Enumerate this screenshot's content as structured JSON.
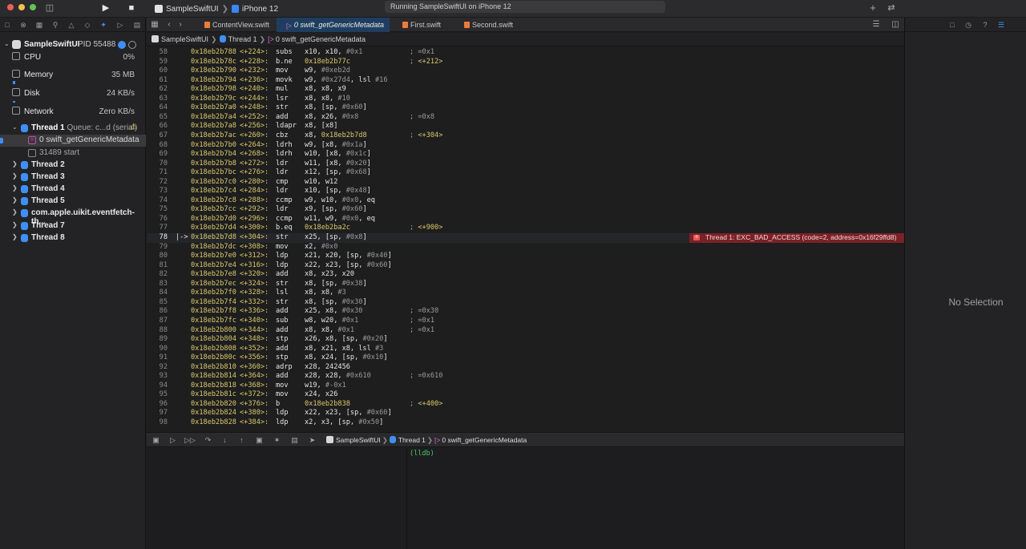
{
  "toolbar": {
    "scheme_app": "SampleSwiftUI",
    "scheme_device": "iPhone 12",
    "status": "Running SampleSwiftUI on iPhone 12"
  },
  "navigator": {
    "process_name": "SampleSwiftUI",
    "process_pid": "PID 55488",
    "gauges": [
      {
        "label": "CPU",
        "value": "0%",
        "level": 0.0
      },
      {
        "label": "Memory",
        "value": "35 MB",
        "level": 0.55
      },
      {
        "label": "Disk",
        "value": "24 KB/s",
        "level": 0.25
      },
      {
        "label": "Network",
        "value": "Zero KB/s",
        "level": 0.0
      }
    ],
    "thread1": {
      "label": "Thread 1",
      "queue": "Queue: c...d (serial)"
    },
    "frames": [
      {
        "label": "0 swift_getGenericMetadata"
      },
      {
        "label": "31489 start"
      }
    ],
    "threads": [
      {
        "label": "Thread 2"
      },
      {
        "label": "Thread 3"
      },
      {
        "label": "Thread 4"
      },
      {
        "label": "Thread 5"
      },
      {
        "label": "com.apple.uikit.eventfetch-th..."
      },
      {
        "label": "Thread 7"
      },
      {
        "label": "Thread 8"
      }
    ]
  },
  "editor": {
    "tabs": [
      {
        "label": "ContentView.swift"
      },
      {
        "label": "0 swift_getGenericMetadata"
      },
      {
        "label": "First.swift"
      },
      {
        "label": "Second.swift"
      }
    ],
    "jumpbar": {
      "app": "SampleSwiftUI",
      "thread": "Thread 1",
      "frame": "0 swift_getGenericMetadata"
    },
    "current_pc_marker": "|->",
    "lines": [
      {
        "n": "58",
        "addr": "0x18eb2b788",
        "off": "<+224>:",
        "op": "subs",
        "args": "x10, x10, #0x1",
        "cmt": "; =0x1"
      },
      {
        "n": "59",
        "addr": "0x18eb2b78c",
        "off": "<+228>:",
        "op": "b.ne",
        "args": "0x18eb2b77c",
        "cmt": "; <+212>"
      },
      {
        "n": "60",
        "addr": "0x18eb2b790",
        "off": "<+232>:",
        "op": "mov",
        "args": "w9, #0xeb2d",
        "cmt": ""
      },
      {
        "n": "61",
        "addr": "0x18eb2b794",
        "off": "<+236>:",
        "op": "movk",
        "args": "w9, #0x27d4, lsl #16",
        "cmt": ""
      },
      {
        "n": "62",
        "addr": "0x18eb2b798",
        "off": "<+240>:",
        "op": "mul",
        "args": "x8, x8, x9",
        "cmt": ""
      },
      {
        "n": "63",
        "addr": "0x18eb2b79c",
        "off": "<+244>:",
        "op": "lsr",
        "args": "x8, x8, #10",
        "cmt": ""
      },
      {
        "n": "64",
        "addr": "0x18eb2b7a0",
        "off": "<+248>:",
        "op": "str",
        "args": "x8, [sp, #0x60]",
        "cmt": ""
      },
      {
        "n": "65",
        "addr": "0x18eb2b7a4",
        "off": "<+252>:",
        "op": "add",
        "args": "x8, x26, #0x8",
        "cmt": "; =0x8"
      },
      {
        "n": "66",
        "addr": "0x18eb2b7a8",
        "off": "<+256>:",
        "op": "ldapr",
        "args": "x8, [x8]",
        "cmt": ""
      },
      {
        "n": "67",
        "addr": "0x18eb2b7ac",
        "off": "<+260>:",
        "op": "cbz",
        "args": "x8, 0x18eb2b7d8",
        "cmt": "; <+304>"
      },
      {
        "n": "68",
        "addr": "0x18eb2b7b0",
        "off": "<+264>:",
        "op": "ldrh",
        "args": "w9, [x8, #0x1a]",
        "cmt": ""
      },
      {
        "n": "69",
        "addr": "0x18eb2b7b4",
        "off": "<+268>:",
        "op": "ldrh",
        "args": "w10, [x8, #0x1c]",
        "cmt": ""
      },
      {
        "n": "70",
        "addr": "0x18eb2b7b8",
        "off": "<+272>:",
        "op": "ldr",
        "args": "w11, [x8, #0x20]",
        "cmt": ""
      },
      {
        "n": "71",
        "addr": "0x18eb2b7bc",
        "off": "<+276>:",
        "op": "ldr",
        "args": "x12, [sp, #0x68]",
        "cmt": ""
      },
      {
        "n": "72",
        "addr": "0x18eb2b7c0",
        "off": "<+280>:",
        "op": "cmp",
        "args": "w10, w12",
        "cmt": ""
      },
      {
        "n": "73",
        "addr": "0x18eb2b7c4",
        "off": "<+284>:",
        "op": "ldr",
        "args": "x10, [sp, #0x48]",
        "cmt": ""
      },
      {
        "n": "74",
        "addr": "0x18eb2b7c8",
        "off": "<+288>:",
        "op": "ccmp",
        "args": "w9, w10, #0x0, eq",
        "cmt": ""
      },
      {
        "n": "75",
        "addr": "0x18eb2b7cc",
        "off": "<+292>:",
        "op": "ldr",
        "args": "x9, [sp, #0x60]",
        "cmt": ""
      },
      {
        "n": "76",
        "addr": "0x18eb2b7d0",
        "off": "<+296>:",
        "op": "ccmp",
        "args": "w11, w9, #0x0, eq",
        "cmt": ""
      },
      {
        "n": "77",
        "addr": "0x18eb2b7d4",
        "off": "<+300>:",
        "op": "b.eq",
        "args": "0x18eb2ba2c",
        "cmt": "; <+900>"
      },
      {
        "n": "78",
        "addr": "0x18eb2b7d8",
        "off": "<+304>:",
        "op": "str",
        "args": "x25, [sp, #0x8]",
        "cmt": ""
      },
      {
        "n": "79",
        "addr": "0x18eb2b7dc",
        "off": "<+308>:",
        "op": "mov",
        "args": "x2, #0x0",
        "cmt": ""
      },
      {
        "n": "80",
        "addr": "0x18eb2b7e0",
        "off": "<+312>:",
        "op": "ldp",
        "args": "x21, x20, [sp, #0x40]",
        "cmt": ""
      },
      {
        "n": "81",
        "addr": "0x18eb2b7e4",
        "off": "<+316>:",
        "op": "ldp",
        "args": "x22, x23, [sp, #0x60]",
        "cmt": ""
      },
      {
        "n": "82",
        "addr": "0x18eb2b7e8",
        "off": "<+320>:",
        "op": "add",
        "args": "x8, x23, x20",
        "cmt": ""
      },
      {
        "n": "83",
        "addr": "0x18eb2b7ec",
        "off": "<+324>:",
        "op": "str",
        "args": "x8, [sp, #0x38]",
        "cmt": ""
      },
      {
        "n": "84",
        "addr": "0x18eb2b7f0",
        "off": "<+328>:",
        "op": "lsl",
        "args": "x8, x8, #3",
        "cmt": ""
      },
      {
        "n": "85",
        "addr": "0x18eb2b7f4",
        "off": "<+332>:",
        "op": "str",
        "args": "x8, [sp, #0x30]",
        "cmt": ""
      },
      {
        "n": "86",
        "addr": "0x18eb2b7f8",
        "off": "<+336>:",
        "op": "add",
        "args": "x25, x8, #0x30",
        "cmt": "; =0x30"
      },
      {
        "n": "87",
        "addr": "0x18eb2b7fc",
        "off": "<+340>:",
        "op": "sub",
        "args": "w8, w20, #0x1",
        "cmt": "; =0x1"
      },
      {
        "n": "88",
        "addr": "0x18eb2b800",
        "off": "<+344>:",
        "op": "add",
        "args": "x8, x8, #0x1",
        "cmt": "; =0x1"
      },
      {
        "n": "89",
        "addr": "0x18eb2b804",
        "off": "<+348>:",
        "op": "stp",
        "args": "x26, x8, [sp, #0x20]",
        "cmt": ""
      },
      {
        "n": "90",
        "addr": "0x18eb2b808",
        "off": "<+352>:",
        "op": "add",
        "args": "x8, x21, x8, lsl #3",
        "cmt": ""
      },
      {
        "n": "91",
        "addr": "0x18eb2b80c",
        "off": "<+356>:",
        "op": "stp",
        "args": "x8, x24, [sp, #0x10]",
        "cmt": ""
      },
      {
        "n": "92",
        "addr": "0x18eb2b810",
        "off": "<+360>:",
        "op": "adrp",
        "args": "x28, 242456",
        "cmt": ""
      },
      {
        "n": "93",
        "addr": "0x18eb2b814",
        "off": "<+364>:",
        "op": "add",
        "args": "x28, x28, #0x610",
        "cmt": "; =0x610"
      },
      {
        "n": "94",
        "addr": "0x18eb2b818",
        "off": "<+368>:",
        "op": "mov",
        "args": "w19, #-0x1",
        "cmt": ""
      },
      {
        "n": "95",
        "addr": "0x18eb2b81c",
        "off": "<+372>:",
        "op": "mov",
        "args": "x24, x26",
        "cmt": ""
      },
      {
        "n": "96",
        "addr": "0x18eb2b820",
        "off": "<+376>:",
        "op": "b",
        "args": "0x18eb2b838",
        "cmt": "; <+400>"
      },
      {
        "n": "97",
        "addr": "0x18eb2b824",
        "off": "<+380>:",
        "op": "ldp",
        "args": "x22, x23, [sp, #0x60]",
        "cmt": ""
      },
      {
        "n": "98",
        "addr": "0x18eb2b828",
        "off": "<+384>:",
        "op": "ldp",
        "args": "x2, x3, [sp, #0x50]",
        "cmt": ""
      }
    ],
    "error": "Thread 1: EXC_BAD_ACCESS (code=2, address=0x16f29ffd8)"
  },
  "debugbar": {
    "app": "SampleSwiftUI",
    "thread": "Thread 1",
    "frame": "0 swift_getGenericMetadata"
  },
  "console": {
    "prompt": "(lldb)"
  },
  "inspector": {
    "empty_text": "No Selection"
  },
  "colors": {
    "accent": "#3f8ff7",
    "address": "#d9c96b",
    "error_bar": "#7b2127",
    "console_prompt": "#4bc76d"
  }
}
